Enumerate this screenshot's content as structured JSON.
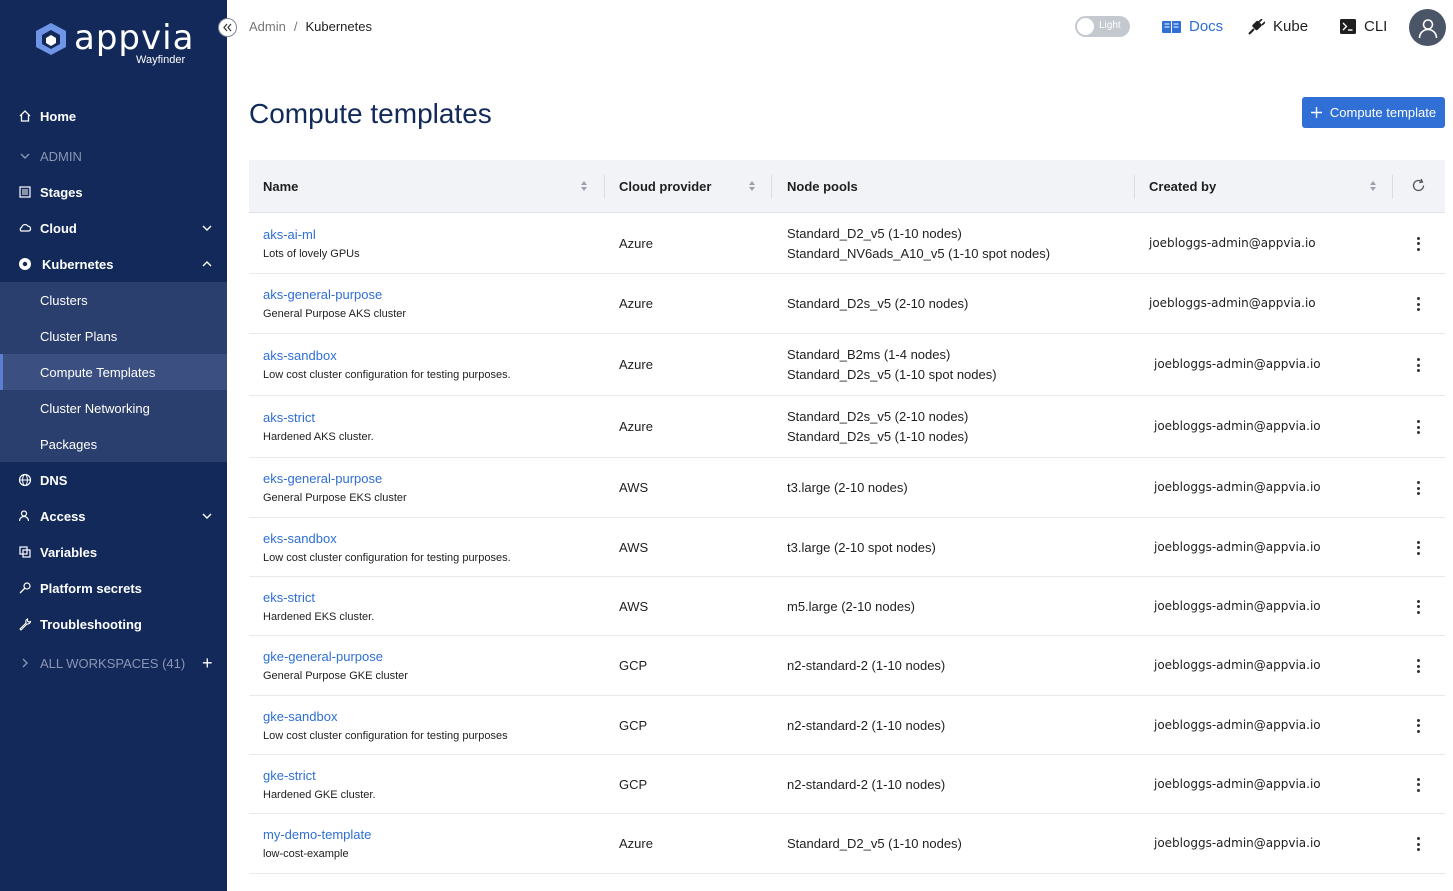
{
  "brand": {
    "name": "appvia",
    "sub": "Wayfinder"
  },
  "sidebar": {
    "items": [
      {
        "label": "Home",
        "icon": "home-icon"
      },
      {
        "label": "ADMIN",
        "icon": "chevron-down-icon"
      },
      {
        "label": "Stages",
        "icon": "stages-icon"
      },
      {
        "label": "Cloud",
        "icon": "cloud-icon"
      },
      {
        "label": "Kubernetes",
        "icon": "kubernetes-icon"
      },
      {
        "label": "Clusters"
      },
      {
        "label": "Cluster Plans"
      },
      {
        "label": "Compute Templates"
      },
      {
        "label": "Cluster Networking"
      },
      {
        "label": "Packages"
      },
      {
        "label": "DNS",
        "icon": "globe-icon"
      },
      {
        "label": "Access",
        "icon": "access-icon"
      },
      {
        "label": "Variables",
        "icon": "variables-icon"
      },
      {
        "label": "Platform secrets",
        "icon": "key-icon"
      },
      {
        "label": "Troubleshooting",
        "icon": "wrench-icon"
      },
      {
        "label": "ALL WORKSPACES (41)",
        "icon": "chevron-right-icon"
      }
    ]
  },
  "breadcrumb": {
    "parent": "Admin",
    "sep": "/",
    "current": "Kubernetes"
  },
  "theme_toggle": {
    "label": "Light"
  },
  "topnav": {
    "docs": "Docs",
    "kube": "Kube",
    "cli": "CLI"
  },
  "page": {
    "title": "Compute templates",
    "add_button": "Compute template"
  },
  "table": {
    "headers": {
      "name": "Name",
      "cloud": "Cloud provider",
      "pools": "Node pools",
      "created": "Created by"
    },
    "rows": [
      {
        "name": "aks-ai-ml",
        "desc": "Lots of lovely GPUs",
        "cloud": "Azure",
        "pools": [
          "Standard_D2_v5 (1-10 nodes)",
          "Standard_NV6ads_A10_v5 (1-10 spot nodes)"
        ],
        "created": "joebloggs-admin@appvia.io"
      },
      {
        "name": "aks-general-purpose",
        "desc": "General Purpose AKS cluster",
        "cloud": "Azure",
        "pools": [
          "Standard_D2s_v5 (2-10 nodes)"
        ],
        "created": "joebloggs-admin@appvia.io"
      },
      {
        "name": "aks-sandbox",
        "desc": "Low cost cluster configuration for testing purposes.",
        "cloud": "Azure",
        "pools": [
          "Standard_B2ms (1-4 nodes)",
          "Standard_D2s_v5 (1-10 spot nodes)"
        ],
        "created": "joebloggs-admin@appvia.io"
      },
      {
        "name": "aks-strict",
        "desc": "Hardened AKS cluster.",
        "cloud": "Azure",
        "pools": [
          "Standard_D2s_v5 (2-10 nodes)",
          "Standard_D2s_v5 (1-10 nodes)"
        ],
        "created": "joebloggs-admin@appvia.io"
      },
      {
        "name": "eks-general-purpose",
        "desc": "General Purpose EKS cluster",
        "cloud": "AWS",
        "pools": [
          "t3.large (2-10 nodes)"
        ],
        "created": "joebloggs-admin@appvia.io"
      },
      {
        "name": "eks-sandbox",
        "desc": "Low cost cluster configuration for testing purposes.",
        "cloud": "AWS",
        "pools": [
          "t3.large (2-10 spot nodes)"
        ],
        "created": "joebloggs-admin@appvia.io"
      },
      {
        "name": "eks-strict",
        "desc": "Hardened EKS cluster.",
        "cloud": "AWS",
        "pools": [
          "m5.large (2-10 nodes)"
        ],
        "created": "joebloggs-admin@appvia.io"
      },
      {
        "name": "gke-general-purpose",
        "desc": "General Purpose GKE cluster",
        "cloud": "GCP",
        "pools": [
          "n2-standard-2 (1-10 nodes)"
        ],
        "created": "joebloggs-admin@appvia.io"
      },
      {
        "name": "gke-sandbox",
        "desc": "Low cost cluster configuration for testing purposes",
        "cloud": "GCP",
        "pools": [
          "n2-standard-2 (1-10 nodes)"
        ],
        "created": "joebloggs-admin@appvia.io"
      },
      {
        "name": "gke-strict",
        "desc": "Hardened GKE cluster.",
        "cloud": "GCP",
        "pools": [
          "n2-standard-2 (1-10 nodes)"
        ],
        "created": "joebloggs-admin@appvia.io"
      },
      {
        "name": "my-demo-template",
        "desc": "low-cost-example",
        "cloud": "Azure",
        "pools": [
          "Standard_D2_v5 (1-10 nodes)"
        ],
        "created": "joebloggs-admin@appvia.io"
      }
    ]
  },
  "colors": {
    "sidebar": "#12295a",
    "accent": "#2f6fd6",
    "title": "#122a5a"
  }
}
